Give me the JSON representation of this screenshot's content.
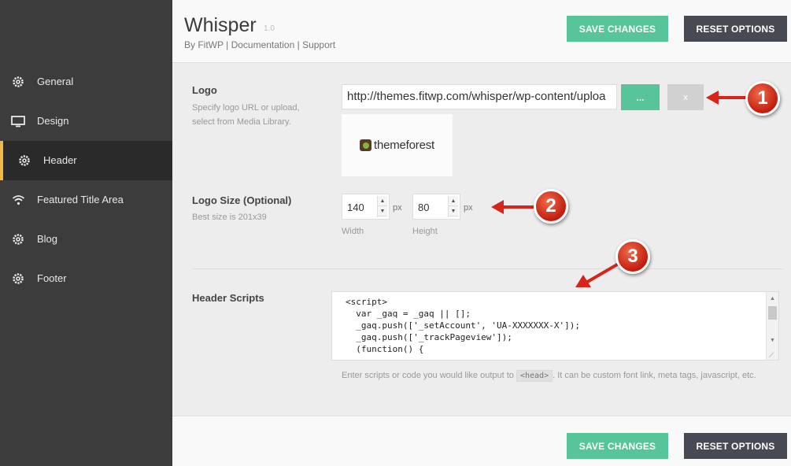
{
  "sidebar": {
    "items": [
      {
        "label": "General",
        "icon": "gear-icon"
      },
      {
        "label": "Design",
        "icon": "monitor-icon"
      },
      {
        "label": "Header",
        "icon": "gear-icon",
        "active": true
      },
      {
        "label": "Featured Title Area",
        "icon": "wifi-icon"
      },
      {
        "label": "Blog",
        "icon": "gear-icon"
      },
      {
        "label": "Footer",
        "icon": "gear-icon"
      }
    ],
    "accent_color": "#f0b849"
  },
  "header": {
    "title": "Whisper",
    "version": "1.0",
    "byline": "By FitWP | Documentation | Support",
    "save_label": "SAVE CHANGES",
    "reset_label": "RESET OPTIONS"
  },
  "logo": {
    "label": "Logo",
    "desc_line1": "Specify logo URL or upload,",
    "desc_line2": "select from Media Library.",
    "url": "http://themes.fitwp.com/whisper/wp-content/uploa",
    "browse_label": "...",
    "remove_label": "x",
    "preview_text": "themeforest"
  },
  "logo_size": {
    "label": "Logo Size (Optional)",
    "desc": "Best size is 201x39",
    "width_value": "140",
    "height_value": "80",
    "unit": "px",
    "width_caption": "Width",
    "height_caption": "Height"
  },
  "header_scripts": {
    "label": "Header Scripts",
    "code": "<script>\n  var _gaq = _gaq || [];\n  _gaq.push(['_setAccount', 'UA-XXXXXXX-X']);\n  _gaq.push(['_trackPageview']);\n  (function() {",
    "help_before": "Enter scripts or code you would like output to",
    "help_tag": "<head>",
    "help_after": ". It can be custom font link, meta tags, javascript, etc."
  },
  "footer": {
    "save_label": "SAVE CHANGES",
    "reset_label": "RESET OPTIONS"
  },
  "callouts": [
    "1",
    "2",
    "3"
  ],
  "colors": {
    "save_green": "#57c49a",
    "reset_dark": "#474a52",
    "sidebar_bg": "#3c3c3c",
    "callout_red": "#c11d0f"
  }
}
